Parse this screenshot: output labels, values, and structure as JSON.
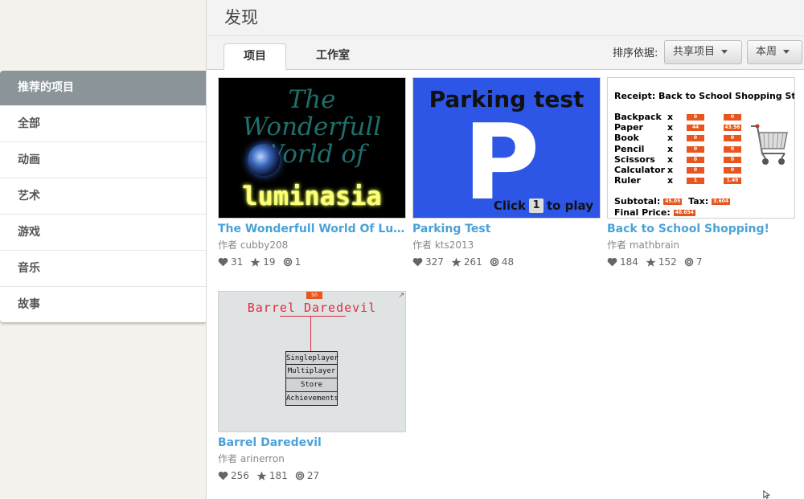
{
  "page": {
    "title": "发现"
  },
  "sidebar": {
    "items": [
      {
        "label": "推荐的项目",
        "active": true
      },
      {
        "label": "全部"
      },
      {
        "label": "动画"
      },
      {
        "label": "艺术"
      },
      {
        "label": "游戏"
      },
      {
        "label": "音乐"
      },
      {
        "label": "故事"
      }
    ]
  },
  "tabs": [
    {
      "label": "项目",
      "active": true
    },
    {
      "label": "工作室"
    }
  ],
  "sort": {
    "label": "排序依据:",
    "type_value": "共享项目",
    "period_value": "本周"
  },
  "author_prefix": "作者",
  "projects": [
    {
      "title": "The Wonderfull World Of Luminasia",
      "author": "cubby208",
      "loves": "31",
      "favorites": "19",
      "remixes": "1",
      "thumb": {
        "script_text": "The Wonderfull World of",
        "logo_text": "luminasia"
      }
    },
    {
      "title": "Parking Test",
      "author": "kts2013",
      "loves": "327",
      "favorites": "261",
      "remixes": "48",
      "thumb": {
        "heading": "Parking test",
        "letter": "P",
        "click_a": "Click",
        "key": "1",
        "click_b": "to play"
      }
    },
    {
      "title": "Back to School Shopping!",
      "author": "mathbrain",
      "loves": "184",
      "favorites": "152",
      "remixes": "7",
      "thumb": {
        "heading": "Receipt: Back to School Shopping Store",
        "x": "x",
        "rows": [
          {
            "name": "Backpack",
            "qty": "0",
            "price": "0"
          },
          {
            "name": "Paper",
            "qty": "44",
            "price": "43.56"
          },
          {
            "name": "Book",
            "qty": "0",
            "price": "0"
          },
          {
            "name": "Pencil",
            "qty": "0",
            "price": "0"
          },
          {
            "name": "Scissors",
            "qty": "0",
            "price": "0"
          },
          {
            "name": "Calculator",
            "qty": "0",
            "price": "0"
          },
          {
            "name": "Ruler",
            "qty": "1",
            "price": "1.49"
          }
        ],
        "subtotal_label": "Subtotal:",
        "subtotal": "45.05",
        "tax_label": "Tax:",
        "tax": "3.604",
        "final_label": "Final Price:",
        "final": "48.654"
      }
    },
    {
      "title": "Barrel Daredevil",
      "author": "arinerron",
      "loves": "256",
      "favorites": "181",
      "remixes": "27",
      "thumb": {
        "score": "50",
        "heading": "Barrel Daredevil",
        "menu": [
          "Singleplayer",
          "Multiplayer",
          "Store",
          "Achievements"
        ]
      }
    }
  ],
  "colors": {
    "link": "#4aa2d8",
    "sidebar_active": "#8b9499",
    "accent_orange": "#e8551d"
  }
}
